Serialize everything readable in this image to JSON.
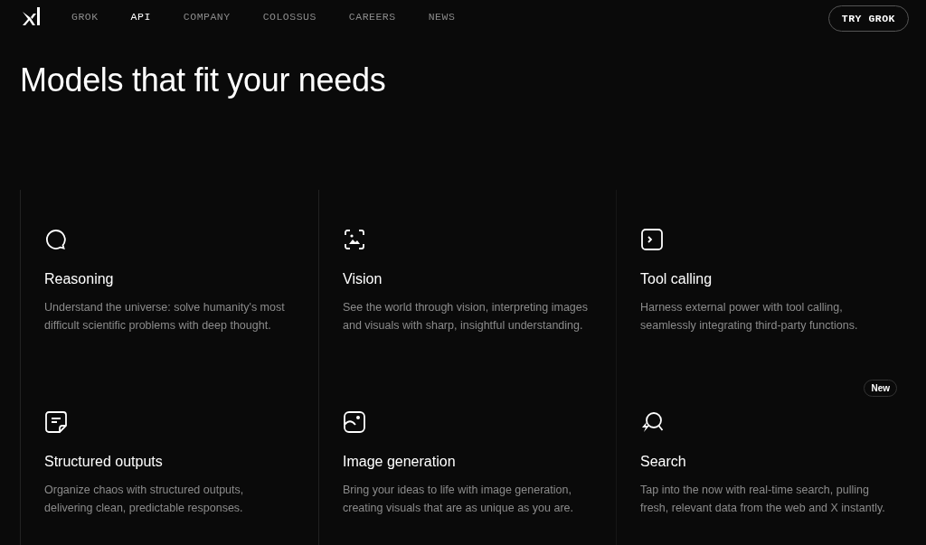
{
  "nav": {
    "items": [
      {
        "label": "GROK",
        "selected": false
      },
      {
        "label": "API",
        "selected": true
      },
      {
        "label": "COMPANY",
        "selected": false
      },
      {
        "label": "COLOSSUS",
        "selected": false
      },
      {
        "label": "CAREERS",
        "selected": false
      },
      {
        "label": "NEWS",
        "selected": false
      }
    ],
    "cta": "TRY GROK"
  },
  "heading": "Models that fit your needs",
  "features": [
    {
      "title": "Reasoning",
      "description": "Understand the universe: solve humanity's most difficult scientific problems with deep thought."
    },
    {
      "title": "Vision",
      "description": "See the world through vision, interpreting images and visuals with sharp, insightful understanding."
    },
    {
      "title": "Tool calling",
      "description": "Harness external power with tool calling, seamlessly integrating third-party functions."
    },
    {
      "title": "Structured outputs",
      "description": "Organize chaos with structured outputs, delivering clean, predictable responses."
    },
    {
      "title": "Image generation",
      "description": "Bring your ideas to life with image generation, creating visuals that are as unique as you are."
    },
    {
      "title": "Search",
      "description": "Tap into the now with real-time search, pulling fresh, relevant data from the web and X instantly.",
      "badge": "New"
    }
  ]
}
